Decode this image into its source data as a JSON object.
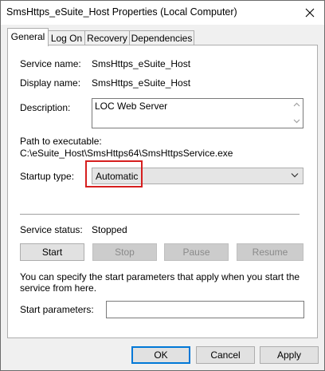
{
  "window": {
    "title": "SmsHttps_eSuite_Host Properties (Local Computer)",
    "close_symbol": "✕"
  },
  "tabs": [
    {
      "label": "General",
      "active": true
    },
    {
      "label": "Log On",
      "active": false
    },
    {
      "label": "Recovery",
      "active": false
    },
    {
      "label": "Dependencies",
      "active": false
    }
  ],
  "general": {
    "service_name_label": "Service name:",
    "service_name_value": "SmsHttps_eSuite_Host",
    "display_name_label": "Display name:",
    "display_name_value": "SmsHttps_eSuite_Host",
    "description_label": "Description:",
    "description_value": "LOC Web Server",
    "path_label": "Path to executable:",
    "path_value": "C:\\eSuite_Host\\SmsHttps64\\SmsHttpsService.exe",
    "startup_type_label": "Startup type:",
    "startup_type_value": "Automatic",
    "service_status_label": "Service status:",
    "service_status_value": "Stopped",
    "start_button": "Start",
    "stop_button": "Stop",
    "pause_button": "Pause",
    "resume_button": "Resume",
    "info_text": "You can specify the start parameters that apply when you start the service from here.",
    "start_params_label": "Start parameters:",
    "start_params_value": ""
  },
  "footer": {
    "ok_button": "OK",
    "cancel_button": "Cancel",
    "apply_button": "Apply"
  },
  "colors": {
    "highlight_box": "#d61f1f",
    "default_button_border": "#0078d7"
  }
}
